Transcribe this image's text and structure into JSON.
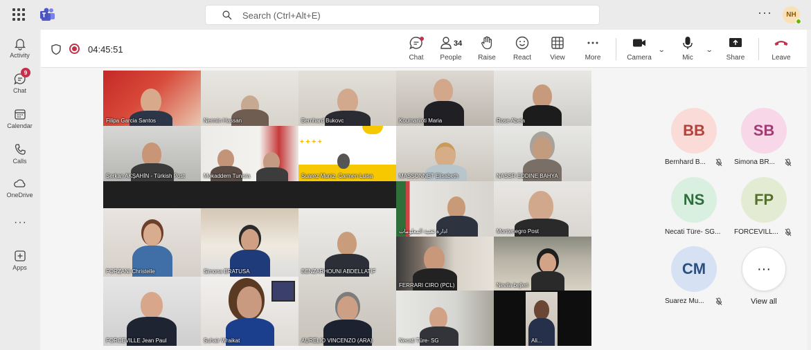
{
  "topbar": {
    "search_placeholder": "Search (Ctrl+Alt+E)",
    "more_label": "···",
    "user_initials": "NH"
  },
  "rail": {
    "items": [
      {
        "label": "Activity",
        "icon": "bell-icon"
      },
      {
        "label": "Chat",
        "icon": "chat-icon",
        "badge": "9"
      },
      {
        "label": "Calendar",
        "icon": "calendar-icon"
      },
      {
        "label": "Calls",
        "icon": "phone-icon"
      },
      {
        "label": "OneDrive",
        "icon": "cloud-icon"
      },
      {
        "label": "Apps",
        "icon": "plus-square-icon"
      }
    ],
    "more": "···"
  },
  "meeting": {
    "timer": "04:45:51",
    "toolbar": {
      "chat": "Chat",
      "people": "People",
      "people_count": "34",
      "raise": "Raise",
      "react": "React",
      "view": "View",
      "more": "More",
      "camera": "Camera",
      "mic": "Mic",
      "share": "Share",
      "leave": "Leave"
    }
  },
  "tiles": [
    {
      "name": "Filipa Garcia Santos"
    },
    {
      "name": "Nermin Hassan"
    },
    {
      "name": "Bernhard Bukovc"
    },
    {
      "name": "Koumanioti Maria"
    },
    {
      "name": "Rose Abela"
    },
    {
      "name": "Serkan AKŞAHİN - Türkish Post"
    },
    {
      "name": "Mokaddem Tunisia"
    },
    {
      "name": "Suarez Muniz, Carmen Luisa"
    },
    {
      "name": "MASSONNET Elisabeth"
    },
    {
      "name": "NASSR EDDINE BAHYA"
    },
    {
      "name": "ادارة تقنية المعلومات"
    },
    {
      "name": "Montenegro Post"
    },
    {
      "name": "FORZANI Christelle"
    },
    {
      "name": "Simona BRATUSA"
    },
    {
      "name": "BENZARHOUNI ABDELLATIF"
    },
    {
      "name": "FERRARI CIRO (PCL)"
    },
    {
      "name": "Nevila bejleri"
    },
    {
      "name": "FORCEVILLE Jean Paul"
    },
    {
      "name": "Suhair Wraikat"
    },
    {
      "name": "AURELIO VINCENZO (ARA)"
    },
    {
      "name": "Necati Türe- SG"
    },
    {
      "name": "Ali..."
    }
  ],
  "roster": [
    {
      "initials": "BB",
      "name": "Bernhard B...",
      "bg": "#fbdbd7",
      "fg": "#b3403a"
    },
    {
      "initials": "SB",
      "name": "Simona BR...",
      "bg": "#f7d7e8",
      "fg": "#a33b72"
    },
    {
      "initials": "NS",
      "name": "Necati Türe- SG...",
      "bg": "#d9f0e0",
      "fg": "#2f6d3e"
    },
    {
      "initials": "FP",
      "name": "FORCEVILL...",
      "bg": "#e3ecd3",
      "fg": "#55702c"
    },
    {
      "initials": "CM",
      "name": "Suarez Mu...",
      "bg": "#d6e2f3",
      "fg": "#2c4f7f"
    }
  ],
  "view_all": "View all",
  "view_all_icon": "···"
}
